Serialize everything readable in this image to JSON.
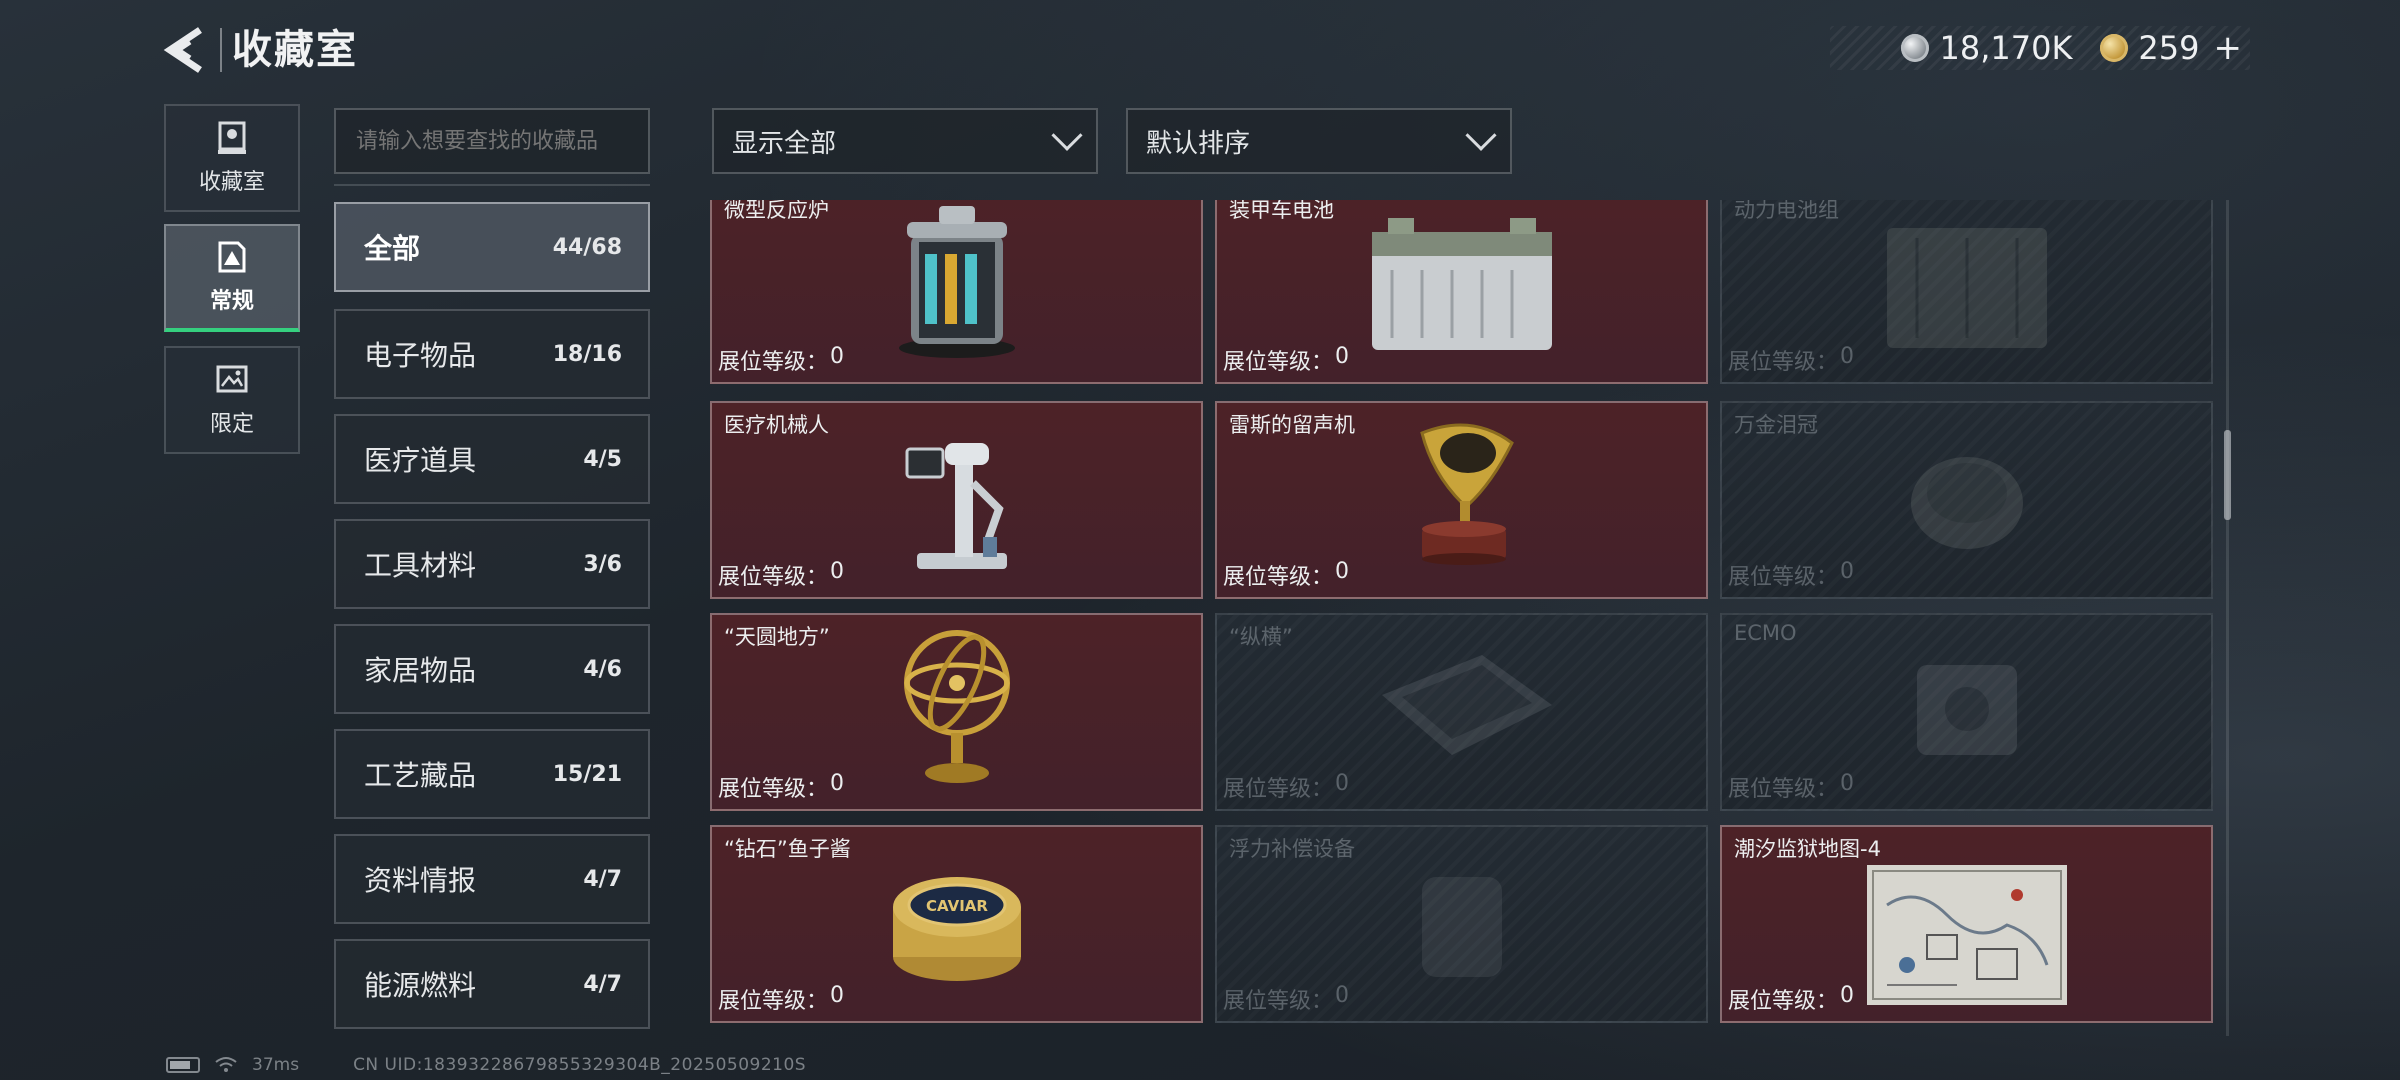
{
  "header": {
    "title": "收藏室",
    "currencies": [
      {
        "icon": "silver-coin-icon",
        "value": "18,170K"
      },
      {
        "icon": "gold-coin-icon",
        "value": "259",
        "add_label": "+"
      }
    ]
  },
  "side_tabs": [
    {
      "label": "收藏室",
      "icon": "trophy-case-icon",
      "active": false
    },
    {
      "label": "常规",
      "icon": "warning-card-icon",
      "active": true
    },
    {
      "label": "限定",
      "icon": "framed-picture-icon",
      "active": false
    }
  ],
  "search": {
    "placeholder": "请输入想要查找的收藏品",
    "value": ""
  },
  "filters": {
    "display": {
      "selected": "显示全部"
    },
    "sort": {
      "selected": "默认排序"
    }
  },
  "categories": [
    {
      "name": "全部",
      "count": "44/68",
      "active": true
    },
    {
      "name": "电子物品",
      "count": "18/16",
      "active": false
    },
    {
      "name": "医疗道具",
      "count": "4/5",
      "active": false
    },
    {
      "name": "工具材料",
      "count": "3/6",
      "active": false
    },
    {
      "name": "家居物品",
      "count": "4/6",
      "active": false
    },
    {
      "name": "工艺藏品",
      "count": "15/21",
      "active": false
    },
    {
      "name": "资料情报",
      "count": "4/7",
      "active": false
    },
    {
      "name": "能源燃料",
      "count": "4/7",
      "active": false
    }
  ],
  "level_label": "展位等级：",
  "items": [
    {
      "title": "微型反应炉",
      "level": "0",
      "unlocked": true,
      "icon": "micro-reactor-icon"
    },
    {
      "title": "装甲车电池",
      "level": "0",
      "unlocked": true,
      "icon": "vehicle-battery-icon"
    },
    {
      "title": "动力电池组",
      "level": "0",
      "unlocked": false,
      "icon": "power-battery-pack-icon"
    },
    {
      "title": "医疗机械人",
      "level": "0",
      "unlocked": true,
      "icon": "medical-robot-icon"
    },
    {
      "title": "雷斯的留声机",
      "level": "0",
      "unlocked": true,
      "icon": "gramophone-icon"
    },
    {
      "title": "万金泪冠",
      "level": "0",
      "unlocked": false,
      "icon": "crown-icon"
    },
    {
      "title": "“天圆地方”",
      "level": "0",
      "unlocked": true,
      "icon": "armillary-sphere-icon"
    },
    {
      "title": "“纵横”",
      "level": "0",
      "unlocked": false,
      "icon": "chessboard-icon"
    },
    {
      "title": "ECMO",
      "level": "0",
      "unlocked": false,
      "icon": "ecmo-machine-icon"
    },
    {
      "title": "“钻石”鱼子酱",
      "level": "0",
      "unlocked": true,
      "icon": "caviar-tin-icon",
      "art_text": "CAVIAR"
    },
    {
      "title": "浮力补偿设备",
      "level": "0",
      "unlocked": false,
      "icon": "buoyancy-device-icon"
    },
    {
      "title": "潮汐监狱地图-4",
      "level": "0",
      "unlocked": true,
      "icon": "prison-map-icon"
    }
  ],
  "status": {
    "ping": "37ms",
    "uid": "CN UID:18393228679855329304B_20250509210S"
  }
}
